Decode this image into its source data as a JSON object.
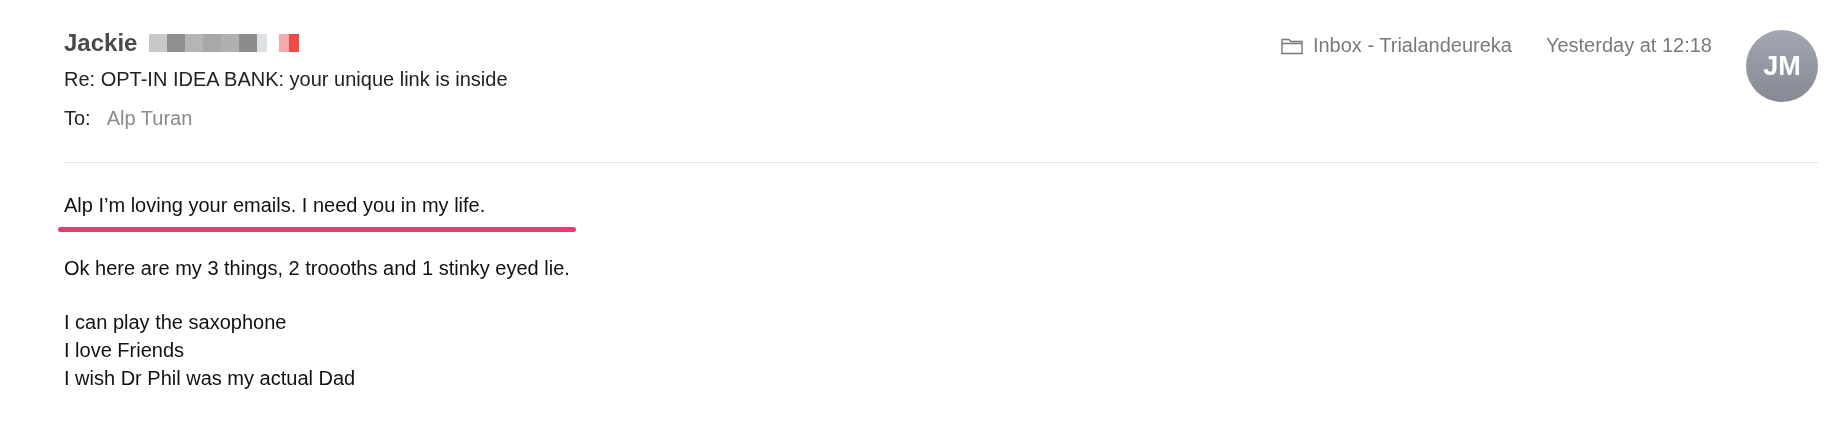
{
  "message": {
    "sender": "Jackie",
    "subject": "Re: OPT-IN IDEA BANK: your unique link is inside",
    "to_label": "To:",
    "recipient": "Alp Turan",
    "mailbox": "Inbox - Trialandeureka",
    "date": "Yesterday at 12:18",
    "avatar_initials": "JM"
  },
  "paragraphs": [
    {
      "underlined": true,
      "lines": [
        "Alp I’m loving your emails. I need you in my life."
      ]
    },
    {
      "underlined": false,
      "lines": [
        "Ok here are my 3 things, 2 troooths and 1 stinky eyed lie."
      ]
    },
    {
      "underlined": false,
      "lines": [
        "I can play the saxophone",
        "I love Friends",
        "I wish Dr Phil was my actual Dad"
      ]
    }
  ]
}
